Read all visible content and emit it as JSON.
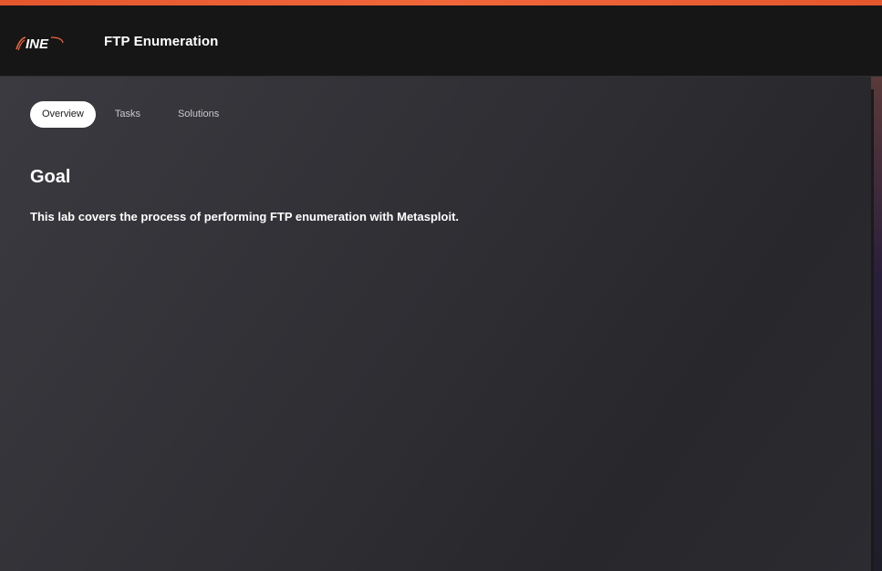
{
  "header": {
    "logo_text": "INE",
    "lab_title": "FTP Enumeration"
  },
  "tabs": [
    {
      "label": "Overview",
      "active": true
    },
    {
      "label": "Tasks",
      "active": false
    },
    {
      "label": "Solutions",
      "active": false
    }
  ],
  "overview": {
    "heading": "Goal",
    "description": "This lab covers the process of performing FTP enumeration with Metasploit."
  },
  "colors": {
    "accent": "#e4572e",
    "header_bg": "#161616",
    "content_bg": "#2f2f34"
  }
}
